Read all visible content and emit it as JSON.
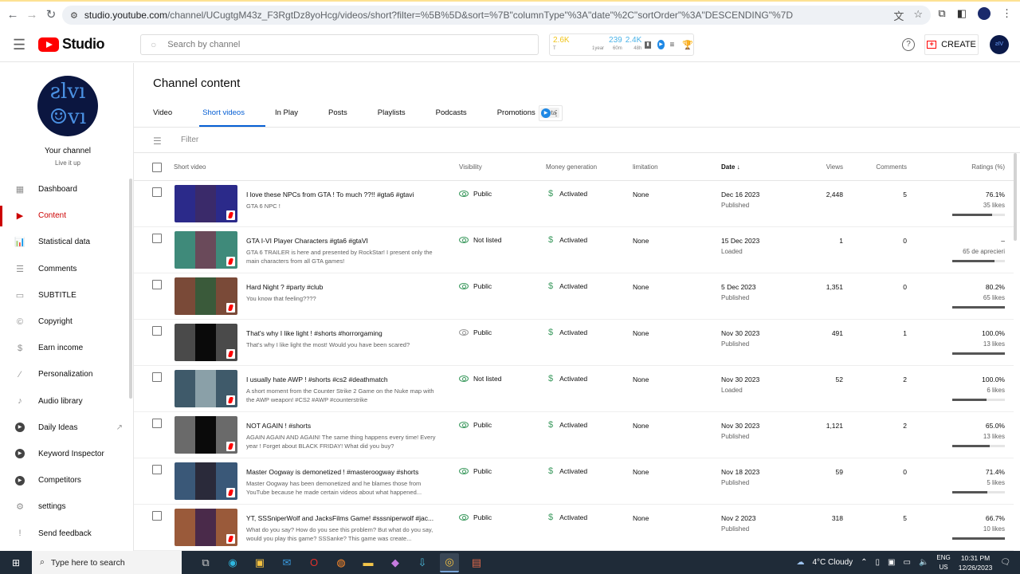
{
  "browser": {
    "url_domain": "studio.youtube.com",
    "url_path": "/channel/UCugtgM43z_F3RgtDz8yoHcg/videos/short?filter=%5B%5D&sort=%7B\"columnType\"%3A\"date\"%2C\"sortOrder\"%3A\"DESCENDING\"%7D"
  },
  "header": {
    "logo_text": "Studio",
    "search_placeholder": "Search by channel",
    "widget": {
      "total": "2.6K",
      "total_sub": "T",
      "year_label": "1year",
      "views_60m": "239",
      "label_60m": "60m",
      "views_48h": "2.4K",
      "label_48h": "48h"
    },
    "help_label": "?",
    "create_label": "CREATE"
  },
  "sidebar": {
    "channel_name": "Your channel",
    "channel_subtitle": "Live it up",
    "items": [
      {
        "label": "Dashboard",
        "icon": "dashboard-icon",
        "glyph": "▦",
        "active": false
      },
      {
        "label": "Content",
        "icon": "content-icon",
        "glyph": "▶",
        "active": true
      },
      {
        "label": "Statistical data",
        "icon": "analytics-icon",
        "glyph": "📊",
        "active": false
      },
      {
        "label": "Comments",
        "icon": "comments-icon",
        "glyph": "☰",
        "active": false
      },
      {
        "label": "SUBTITLE",
        "icon": "subtitles-icon",
        "glyph": "▭",
        "active": false
      },
      {
        "label": "Copyright",
        "icon": "copyright-icon",
        "glyph": "©",
        "active": false
      },
      {
        "label": "Earn income",
        "icon": "dollar-icon",
        "glyph": "$",
        "active": false
      },
      {
        "label": "Personalization",
        "icon": "magic-wand-icon",
        "glyph": "⁄",
        "active": false
      },
      {
        "label": "Audio library",
        "icon": "audio-library-icon",
        "glyph": "♪",
        "active": false
      },
      {
        "label": "Daily Ideas",
        "icon": "vidiq-icon",
        "glyph": "▸",
        "active": false,
        "external": true
      },
      {
        "label": "Keyword Inspector",
        "icon": "vidiq-icon",
        "glyph": "▸",
        "active": false
      },
      {
        "label": "Competitors",
        "icon": "vidiq-icon",
        "glyph": "▸",
        "active": false
      },
      {
        "label": "settings",
        "icon": "gear-icon",
        "glyph": "⚙",
        "active": false
      },
      {
        "label": "Send feedback",
        "icon": "feedback-icon",
        "glyph": "!",
        "active": false
      }
    ]
  },
  "main": {
    "page_title": "Channel content",
    "tabs": [
      {
        "label": "Video",
        "active": false
      },
      {
        "label": "Short videos",
        "active": true
      },
      {
        "label": "In Play",
        "active": false
      },
      {
        "label": "Posts",
        "active": false
      },
      {
        "label": "Playlists",
        "active": false
      },
      {
        "label": "Podcasts",
        "active": false
      },
      {
        "label": "Promotions",
        "active": false
      }
    ],
    "beta_label": "Beta",
    "filter_placeholder": "Filter",
    "columns": {
      "video": "Short video",
      "visibility": "Visibility",
      "money": "Money generation",
      "limitation": "limitation",
      "date": "Date",
      "views": "Views",
      "comments": "Comments",
      "ratings": "Ratings (%)"
    },
    "rows": [
      {
        "title": "I love these NPCs from GTA ! To much ??!! #gta6 #gtavi",
        "description": "GTA 6 NPC !",
        "visibility": "Public",
        "visibility_active": true,
        "money": "Activated",
        "limitation": "None",
        "date": "Dec 16 2023",
        "status": "Published",
        "views": "2,448",
        "comments": "5",
        "rating": "76.1%",
        "likes": "35 likes",
        "rating_fraction": 0.761,
        "thumb_bg": "#2b2a8a",
        "thumb_inner": "#3a2a6a"
      },
      {
        "title": "GTA I-VI Player Characters #gta6 #gtaVI",
        "description": "GTA 6 TRAILER is here and presented by RockStar! I present only the main characters from all GTA games!",
        "visibility": "Not listed",
        "visibility_active": true,
        "money": "Activated",
        "limitation": "None",
        "date": "15 Dec 2023",
        "status": "Loaded",
        "views": "1",
        "comments": "0",
        "rating": "–",
        "likes": "65 de aprecieri",
        "rating_fraction": 0.8,
        "thumb_bg": "#3f8a7a",
        "thumb_inner": "#6a4a5a"
      },
      {
        "title": "Hard Night ? #party #club",
        "description": "You know that feeling????",
        "visibility": "Public",
        "visibility_active": true,
        "money": "Activated",
        "limitation": "None",
        "date": "5 Dec 2023",
        "status": "Published",
        "views": "1,351",
        "comments": "0",
        "rating": "80.2%",
        "likes": "65 likes",
        "rating_fraction": 1.0,
        "thumb_bg": "#7a4a38",
        "thumb_inner": "#3a5a3a"
      },
      {
        "title": "That's why I like light ! #shorts #horrorgaming",
        "description": "That's why I like light the most! Would you have been scared?",
        "visibility": "Public",
        "visibility_active": false,
        "money": "Activated",
        "limitation": "None",
        "date": "Nov 30 2023",
        "status": "Published",
        "views": "491",
        "comments": "1",
        "rating": "100.0%",
        "likes": "13 likes",
        "rating_fraction": 1.0,
        "thumb_bg": "#4a4a4a",
        "thumb_inner": "#0a0a0a"
      },
      {
        "title": "I usually hate AWP ! #shorts #cs2 #deathmatch",
        "description": "A short moment from the Counter Strike 2 Game on the Nuke map with the AWP weapon! #CS2 #AWP #counterstrike",
        "visibility": "Not listed",
        "visibility_active": true,
        "money": "Activated",
        "limitation": "None",
        "date": "Nov 30 2023",
        "status": "Loaded",
        "views": "52",
        "comments": "2",
        "rating": "100.0%",
        "likes": "6 likes",
        "rating_fraction": 0.65,
        "thumb_bg": "#3f5a6a",
        "thumb_inner": "#8aa0a8"
      },
      {
        "title": "NOT AGAIN ! #shorts",
        "description": "AGAIN AGAIN AND AGAIN! The same thing happens every time! Every year ! Forget about BLACK FRIDAY! What did you buy?",
        "visibility": "Public",
        "visibility_active": true,
        "money": "Activated",
        "limitation": "None",
        "date": "Nov 30 2023",
        "status": "Published",
        "views": "1,121",
        "comments": "2",
        "rating": "65.0%",
        "likes": "13 likes",
        "rating_fraction": 0.71,
        "thumb_bg": "#6a6a6a",
        "thumb_inner": "#0a0a0a"
      },
      {
        "title": "Master Oogway is demonetized ! #masteroogway #shorts",
        "description": "Master Oogway has been demonetized and he blames those from YouTube because he made certain videos about what happened...",
        "visibility": "Public",
        "visibility_active": true,
        "money": "Activated",
        "limitation": "None",
        "date": "Nov 18 2023",
        "status": "Published",
        "views": "59",
        "comments": "0",
        "rating": "71.4%",
        "likes": "5 likes",
        "rating_fraction": 0.67,
        "thumb_bg": "#3a5878",
        "thumb_inner": "#2a2a3a"
      },
      {
        "title": "YT, SSSniperWolf and JacksFilms Game! #sssniperwolf #jac...",
        "description": "What do you say? How do you see this problem? But what do you say, would you play this game? SSSanke? This game was create...",
        "visibility": "Public",
        "visibility_active": true,
        "money": "Activated",
        "limitation": "None",
        "date": "Nov 2 2023",
        "status": "Published",
        "views": "318",
        "comments": "5",
        "rating": "66.7%",
        "likes": "10 likes",
        "rating_fraction": 1.0,
        "thumb_bg": "#9a5a3a",
        "thumb_inner": "#4a2a4a"
      }
    ]
  },
  "taskbar": {
    "search_placeholder": "Type here to search",
    "weather": "4°C  Cloudy",
    "lang_top": "ENG",
    "lang_bottom": "US",
    "time": "10:31 PM",
    "date": "12/26/2023"
  }
}
